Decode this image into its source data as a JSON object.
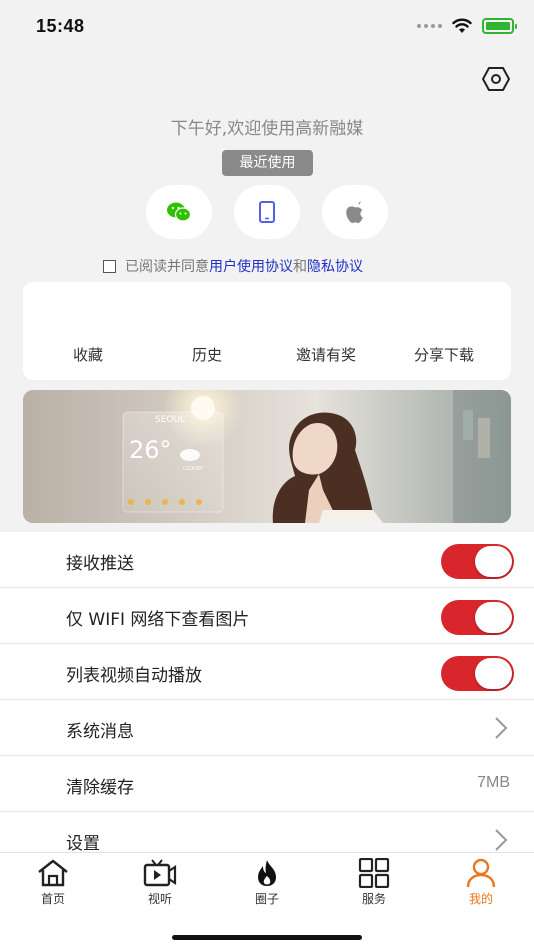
{
  "status": {
    "time": "15:48"
  },
  "header": {
    "greeting": "下午好,欢迎使用高新融媒",
    "recent_label": "最近使用"
  },
  "login": {
    "methods": [
      {
        "icon": "wechat-icon"
      },
      {
        "icon": "phone-icon"
      },
      {
        "icon": "apple-icon"
      }
    ]
  },
  "agreement": {
    "prefix": "已阅读并同意",
    "user_agreement": "用户使用协议",
    "and": "和",
    "privacy_policy": "隐私协议",
    "checked": false
  },
  "quick_actions": [
    {
      "label": "收藏"
    },
    {
      "label": "历史"
    },
    {
      "label": "邀请有奖"
    },
    {
      "label": "分享下载"
    }
  ],
  "banner": {
    "city": "SEOUL",
    "temperature": "26°",
    "condition": "CLOUDY"
  },
  "settings": [
    {
      "label": "接收推送",
      "control": "toggle",
      "on": true
    },
    {
      "label": "仅 WIFI 网络下查看图片",
      "control": "toggle",
      "on": true
    },
    {
      "label": "列表视频自动播放",
      "control": "toggle",
      "on": true
    },
    {
      "label": "系统消息",
      "control": "chevron"
    },
    {
      "label": "清除缓存",
      "control": "value",
      "value": "7MB"
    },
    {
      "label": "设置",
      "control": "chevron"
    }
  ],
  "tabs": [
    {
      "label": "首页",
      "icon": "home-icon",
      "active": false
    },
    {
      "label": "视听",
      "icon": "video-icon",
      "active": false
    },
    {
      "label": "圈子",
      "icon": "flame-icon",
      "active": false
    },
    {
      "label": "服务",
      "icon": "grid-icon",
      "active": false
    },
    {
      "label": "我的",
      "icon": "user-icon",
      "active": true
    }
  ],
  "colors": {
    "accent_red": "#d8262c",
    "link_blue": "#2130c4",
    "active_tab": "#e8761c",
    "battery_green": "#2fb52f",
    "wechat_green": "#2dc100",
    "phone_blue": "#5161e8"
  }
}
